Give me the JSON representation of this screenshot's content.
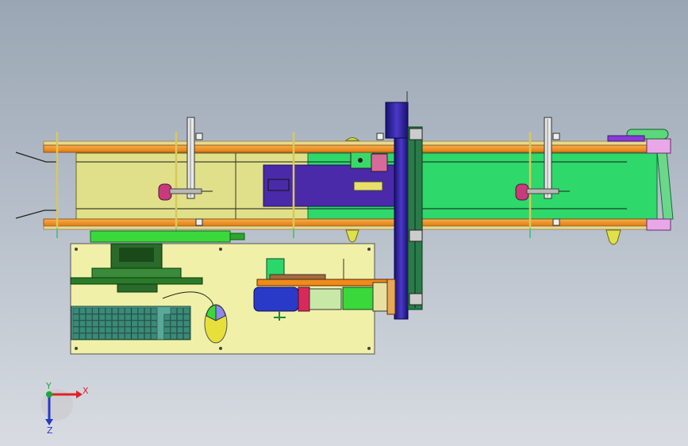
{
  "viewport": {
    "background_top": "#9aa6b4",
    "background_bottom": "#d8dce2"
  },
  "triad": {
    "x_label": "X",
    "y_label": "Y",
    "z_label": "Z",
    "x_color": "#e0202a",
    "y_color": "#1aa83a",
    "z_color": "#2838c8"
  },
  "colors": {
    "rail_orange": "#f08a1a",
    "rail_edge": "#c8a83a",
    "belt_yellow": "#e0e08a",
    "belt_green": "#2ed86a",
    "guide_blue": "#4a2aa8",
    "column_navy": "#2a1a8a",
    "table_yellow": "#f0f0a8",
    "keyboard_teal": "#3a8a78",
    "monitor_green": "#2a6a2a"
  },
  "parts": [
    "conveyor-frame",
    "conveyor-belt",
    "vertical-gantry",
    "sensor-post-left",
    "sensor-post-right",
    "workstation-table",
    "monitor",
    "keyboard",
    "mouse",
    "drive-unit"
  ]
}
